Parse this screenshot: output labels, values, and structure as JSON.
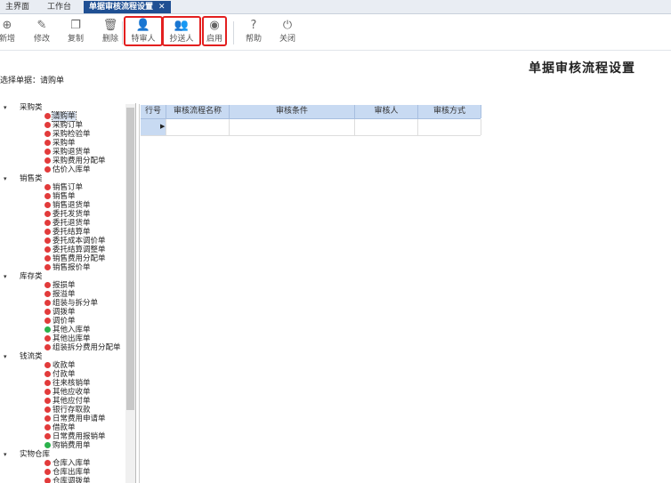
{
  "tabs": [
    {
      "label": "主界面"
    },
    {
      "label": "工作台"
    },
    {
      "label": "单据审核流程设置",
      "close": "✕"
    }
  ],
  "toolbar": [
    {
      "label": "新增",
      "icon": "⊕"
    },
    {
      "label": "修改",
      "icon": "✎"
    },
    {
      "label": "复制",
      "icon": "❐"
    },
    {
      "label": "删除",
      "icon": "🗑"
    },
    {
      "label": "特审人",
      "icon": "👤"
    },
    {
      "label": "抄送人",
      "icon": "👥"
    },
    {
      "label": "启用",
      "icon": "◉"
    },
    {
      "label": "帮助",
      "icon": "?"
    },
    {
      "label": "关闭",
      "icon": "⏻"
    }
  ],
  "page_title": "单据审核流程设置",
  "select_label": "选择单据：请购单",
  "tree": [
    {
      "group": "采购类",
      "items": [
        "请购单",
        "采购订单",
        "采购检验单",
        "采购单",
        "采购退货单",
        "采购费用分配单",
        "估价入库单"
      ]
    },
    {
      "group": "销售类",
      "items": [
        "销售订单",
        "销售单",
        "销售退货单",
        "委托发货单",
        "委托退货单",
        "委托结算单",
        "委托成本调价单",
        "委托结算调整单",
        "销售费用分配单",
        "销售报价单"
      ]
    },
    {
      "group": "库存类",
      "items": [
        "报损单",
        "报溢单",
        "组装与拆分单",
        "调拨单",
        "调价单",
        "其他入库单",
        "其他出库单",
        "组装拆分费用分配单"
      ]
    },
    {
      "group": "钱流类",
      "items": [
        "收款单",
        "付款单",
        "往来核销单",
        "其他应收单",
        "其他应付单",
        "银行存取款",
        "日常费用申请单",
        "借款单",
        "日常费用报销单",
        "购销费用单"
      ]
    },
    {
      "group": "实物仓库",
      "items": [
        "仓库入库单",
        "仓库出库单",
        "仓库调拨单"
      ]
    }
  ],
  "grid": {
    "columns": [
      "行号",
      "审核流程名称",
      "审核条件",
      "审核人",
      "审核方式"
    ]
  }
}
